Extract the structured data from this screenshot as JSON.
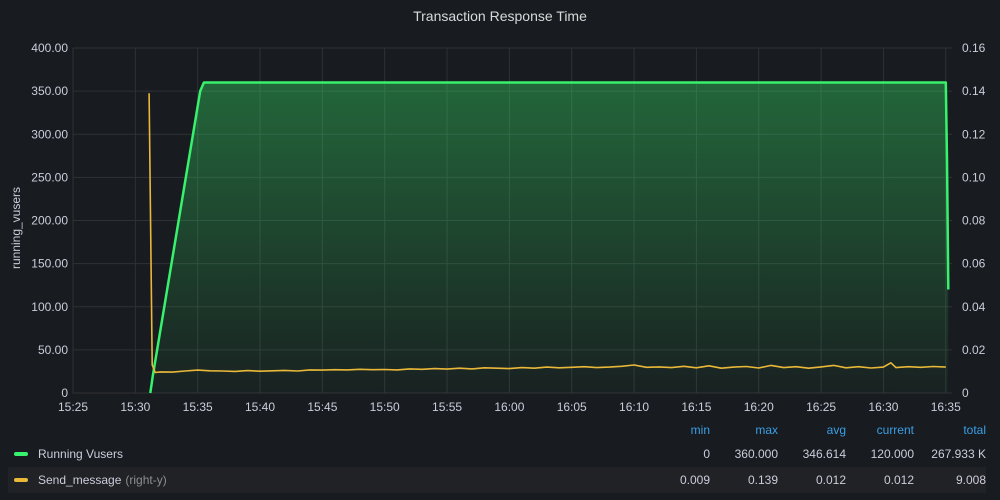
{
  "panel": {
    "title": "Transaction Response Time"
  },
  "colors": {
    "background": "#181b1f",
    "grid": "#2f3136",
    "running_vusers": "#37f26c",
    "send_message": "#eab839",
    "legend_header": "#3a9fe6"
  },
  "chart_data": {
    "type": "line",
    "title": "Transaction Response Time",
    "ylabel": "running_vusers",
    "ylabel_right": "",
    "x_ticks": [
      "15:25",
      "15:30",
      "15:35",
      "15:40",
      "15:45",
      "15:50",
      "15:55",
      "16:00",
      "16:05",
      "16:10",
      "16:15",
      "16:20",
      "16:25",
      "16:30",
      "16:35"
    ],
    "x_tick_minutes": [
      925,
      930,
      935,
      940,
      945,
      950,
      955,
      960,
      965,
      970,
      975,
      980,
      985,
      990,
      995
    ],
    "xlim_minutes": [
      925,
      995.5
    ],
    "ylim_left": [
      0,
      400
    ],
    "y_ticks_left": [
      "0",
      "50.00",
      "100.00",
      "150.00",
      "200.00",
      "250.00",
      "300.00",
      "350.00",
      "400.00"
    ],
    "y_tick_values_left": [
      0,
      50,
      100,
      150,
      200,
      250,
      300,
      350,
      400
    ],
    "ylim_right": [
      0,
      0.16
    ],
    "y_ticks_right": [
      "0",
      "0.02",
      "0.04",
      "0.06",
      "0.08",
      "0.10",
      "0.12",
      "0.14",
      "0.16"
    ],
    "y_tick_values_right": [
      0,
      0.02,
      0.04,
      0.06,
      0.08,
      0.1,
      0.12,
      0.14,
      0.16
    ],
    "grid": true,
    "legend_placement": "bottom",
    "series": [
      {
        "name": "Running Vusers",
        "axis": "left",
        "fill": true,
        "x_minutes": [
          931.2,
          931.4,
          935.2,
          935.5,
          995.0,
          995.1,
          995.2
        ],
        "values": [
          0,
          20,
          350,
          360,
          360,
          270,
          120
        ]
      },
      {
        "name": "Send_message",
        "axis": "right",
        "fill": false,
        "x_minutes": [
          931.1,
          931.35,
          931.6,
          932,
          933,
          934,
          935,
          936,
          937,
          938,
          939,
          940,
          941,
          942,
          943,
          944,
          945,
          946,
          947,
          948,
          949,
          950,
          951,
          952,
          953,
          954,
          955,
          956,
          957,
          958,
          959,
          960,
          961,
          962,
          963,
          964,
          965,
          966,
          967,
          968,
          969,
          970,
          971,
          972,
          973,
          974,
          975,
          976,
          977,
          978,
          979,
          980,
          981,
          982,
          983,
          984,
          985,
          986,
          987,
          988,
          989,
          990,
          990.6,
          991,
          992,
          993,
          994,
          995.0
        ],
        "values": [
          0.139,
          0.013,
          0.0095,
          0.0098,
          0.0097,
          0.0102,
          0.0106,
          0.0103,
          0.0102,
          0.01,
          0.0104,
          0.0101,
          0.0103,
          0.0105,
          0.0102,
          0.0107,
          0.0106,
          0.0108,
          0.0107,
          0.011,
          0.0108,
          0.0109,
          0.0107,
          0.0112,
          0.011,
          0.0113,
          0.0111,
          0.0115,
          0.0112,
          0.0117,
          0.0115,
          0.0113,
          0.0118,
          0.0115,
          0.012,
          0.0117,
          0.0119,
          0.0122,
          0.0118,
          0.012,
          0.0124,
          0.013,
          0.0119,
          0.0121,
          0.0118,
          0.0124,
          0.0117,
          0.0126,
          0.0115,
          0.012,
          0.0123,
          0.0116,
          0.0128,
          0.0118,
          0.0122,
          0.0115,
          0.0121,
          0.0128,
          0.0117,
          0.0122,
          0.0116,
          0.012,
          0.014,
          0.0118,
          0.0122,
          0.0119,
          0.0123,
          0.012
        ]
      }
    ]
  },
  "legend": {
    "headers": [
      "min",
      "max",
      "avg",
      "current",
      "total"
    ],
    "rows": [
      {
        "name": "Running Vusers",
        "axis_note": "",
        "min": "0",
        "max": "360.000",
        "avg": "346.614",
        "current": "120.000",
        "total": "267.933 K"
      },
      {
        "name": "Send_message",
        "axis_note": "(right-y)",
        "min": "0.009",
        "max": "0.139",
        "avg": "0.012",
        "current": "0.012",
        "total": "9.008"
      }
    ]
  }
}
